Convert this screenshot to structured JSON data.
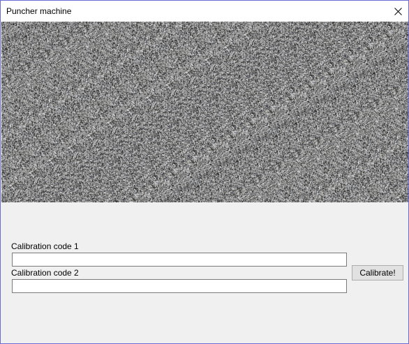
{
  "window": {
    "title": "Puncher machine"
  },
  "icons": {
    "close": "close-icon"
  },
  "colors": {
    "border": "#6b6bd6",
    "titlebar": "#ffffff",
    "form_background": "#f0f0f0",
    "button_background": "#e1e1e1"
  },
  "form": {
    "code1_label": "Calibration code 1",
    "code1_value": "",
    "code2_label": "Calibration code 2",
    "code2_value": "",
    "calibrate_label": "Calibrate!"
  }
}
